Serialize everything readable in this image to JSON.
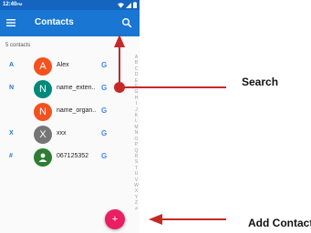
{
  "status_bar": {
    "time": "12:40",
    "time_suffix": "PM"
  },
  "app_bar": {
    "title": "Contacts",
    "menu_icon": "menu-icon",
    "search_icon": "search-icon"
  },
  "contacts_count": "5 contacts",
  "contacts": [
    {
      "letter": "A",
      "initial": "A",
      "name": "Alex",
      "avatar_color": "#f4511e",
      "account_icon": "google-icon"
    },
    {
      "letter": "N",
      "initial": "N",
      "name": "name_exten..",
      "avatar_color": "#00897b",
      "account_icon": "google-icon"
    },
    {
      "letter": "",
      "initial": "N",
      "name": "name_organ..",
      "avatar_color": "#f4511e",
      "account_icon": "google-icon"
    },
    {
      "letter": "X",
      "initial": "X",
      "name": "xxx",
      "avatar_color": "#757575",
      "account_icon": "google-icon"
    },
    {
      "letter": "#",
      "initial": "",
      "name": "067125352",
      "avatar_color": "#2e7d32",
      "account_icon": "person-icon"
    }
  ],
  "alphabet_index": [
    "A",
    "B",
    "C",
    "D",
    "E",
    "F",
    "G",
    "H",
    "I",
    "J",
    "K",
    "L",
    "M",
    "N",
    "O",
    "P",
    "Q",
    "R",
    "S",
    "T",
    "U",
    "V",
    "W",
    "X",
    "Y",
    "Z",
    "#"
  ],
  "fab": {
    "label": "+"
  },
  "annotations": {
    "search_label": "Search",
    "add_contact_label": "Add Contact"
  },
  "colors": {
    "status_bar": "#1565c0",
    "app_bar": "#1976d2",
    "accent": "#e91e63",
    "annotation_arrow": "#c62828"
  }
}
